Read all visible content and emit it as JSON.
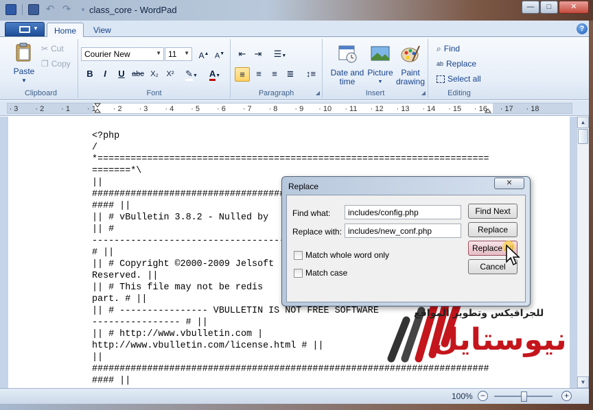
{
  "window": {
    "title": "class_core - WordPad",
    "buttons": {
      "minimize": "—",
      "maximize": "□",
      "close": "✕"
    }
  },
  "tabs": {
    "home": "Home",
    "view": "View",
    "help": "?"
  },
  "ribbon": {
    "clipboard": {
      "label": "Clipboard",
      "paste": "Paste",
      "cut": "Cut",
      "copy": "Copy"
    },
    "font": {
      "label": "Font",
      "family": "Courier New",
      "size": "11",
      "bold": "B",
      "italic": "I",
      "underline": "U",
      "strike": "abc",
      "subscript": "X₂",
      "superscript": "X²",
      "color_letter": "A"
    },
    "paragraph": {
      "label": "Paragraph"
    },
    "insert": {
      "label": "Insert",
      "datetime": "Date and time",
      "picture": "Picture",
      "paint": "Paint drawing"
    },
    "editing": {
      "label": "Editing",
      "find": "Find",
      "replace": "Replace",
      "select_all": "Select all"
    }
  },
  "ruler": {
    "ticks": [
      "3",
      "2",
      "1",
      "1",
      "2",
      "3",
      "4",
      "5",
      "6",
      "7",
      "8",
      "9",
      "10",
      "11",
      "12",
      "13",
      "14",
      "15",
      "16",
      "17",
      "18"
    ]
  },
  "document": {
    "text": "<?php\n/\n*=======================================================================\n=======*\\\n||\n########################################################################\n#### ||\n|| # vBulletin 3.8.2 - Nulled by\n|| #\n------------------------------------------------------------------------\n# ||\n|| # Copyright ©2000-2009 Jelsoft\nReserved. ||\n|| # This file may not be redis\npart. # ||\n|| # ---------------- VBULLETIN IS NOT FREE SOFTWARE\n---------------- # ||\n|| # http://www.vbulletin.com |\nhttp://www.vbulletin.com/license.html # ||\n||\n########################################################################\n#### ||"
  },
  "status": {
    "zoom": "100%",
    "zoom_minus": "−",
    "zoom_plus": "+",
    "zoom_level": 0.5
  },
  "dialog": {
    "title": "Replace",
    "close": "✕",
    "find_label": "Find what:",
    "find_value": "includes/config.php",
    "replace_label": "Replace with:",
    "replace_value": "includes/new_conf.php",
    "whole_word": "Match whole word only",
    "match_case": "Match case",
    "find_next": "Find Next",
    "replace": "Replace",
    "replace_all": "Replace All",
    "cancel": "Cancel"
  },
  "watermark": {
    "subtitle": "للجرافيكس وتطوير المواقع",
    "title": "نيوستايل"
  },
  "colors": {
    "accent": "#15428b",
    "ribbon_bg": "#e6eef8",
    "watermark_red": "#c4151c"
  }
}
